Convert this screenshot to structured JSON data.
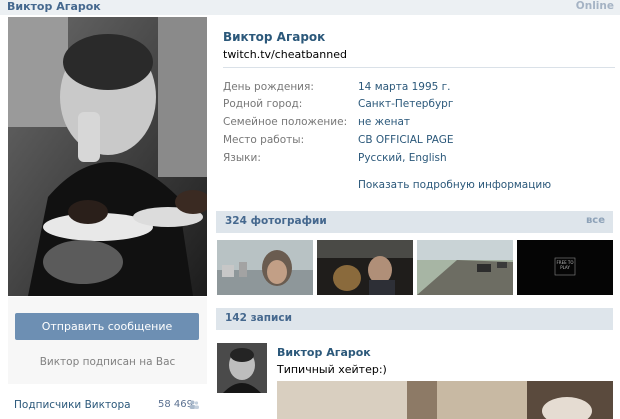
{
  "header": {
    "name": "Виктор Агарок",
    "status": "Online"
  },
  "profile": {
    "name": "Виктор Агарок",
    "status_text": "twitch.tv/cheatbanned",
    "info": [
      {
        "label": "День рождения:",
        "value": "14 марта 1995 г."
      },
      {
        "label": "Родной город:",
        "value": "Санкт-Петербург"
      },
      {
        "label": "Семейное положение:",
        "value": "не женат"
      },
      {
        "label": "Место работы:",
        "value": "CB OFFICIAL PAGE"
      },
      {
        "label": "Языки:",
        "value": "Русский, English"
      }
    ],
    "show_more": "Показать подробную информацию"
  },
  "left": {
    "send_message": "Отправить сообщение",
    "follow_note": "Виктор подписан на Вас",
    "subscribers_label": "Подписчики Виктора",
    "subscribers_count": "58 469"
  },
  "photos": {
    "title": "324 фотографии",
    "all_link": "все",
    "thumb4_text": "FREE TO PLAY"
  },
  "wall": {
    "title": "142 записи",
    "post_author": "Виктор Агарок",
    "post_text": "Типичный хейтер:)"
  },
  "colors": {
    "link": "#2b587a",
    "header_bg": "#dee5eb",
    "button": "#6d8fb3",
    "muted": "#777777"
  },
  "icons": {
    "subscribers": "people-icon"
  }
}
